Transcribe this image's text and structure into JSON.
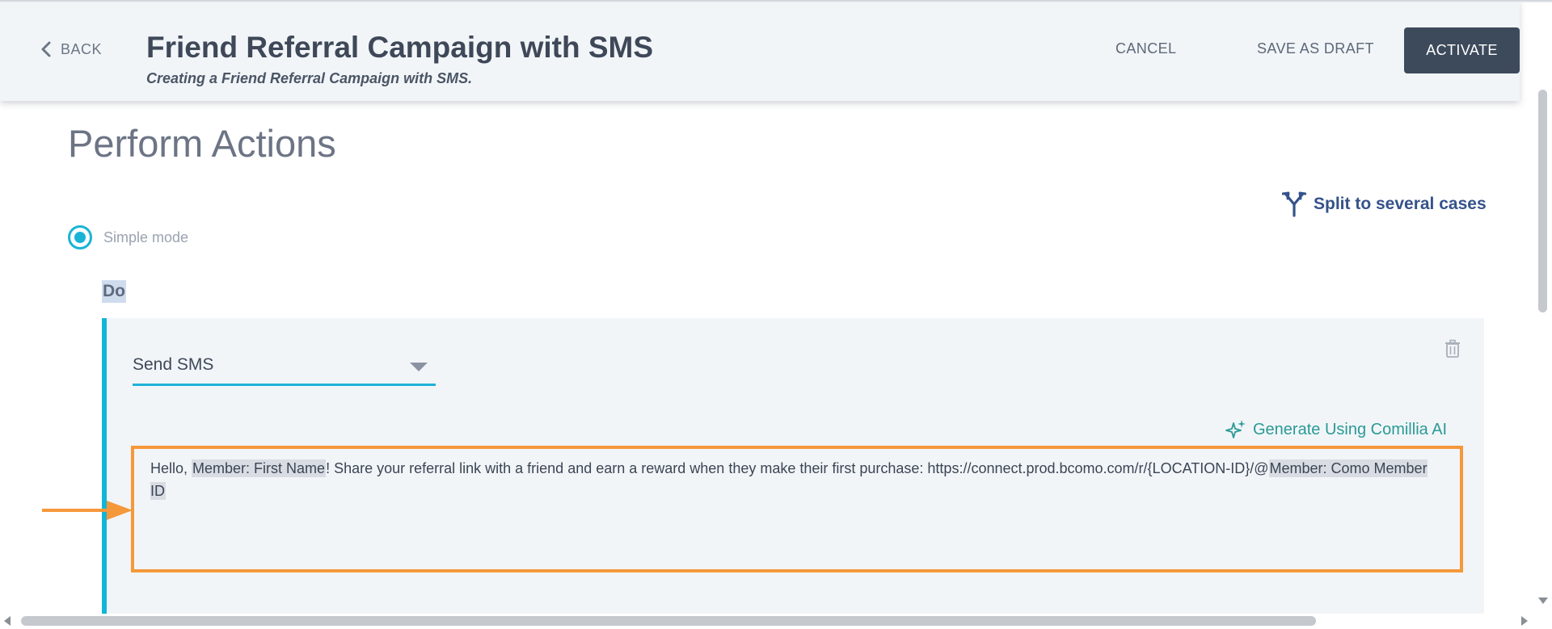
{
  "header": {
    "back_label": "BACK",
    "title": "Friend Referral Campaign with SMS",
    "subtitle": "Creating a Friend Referral Campaign with SMS.",
    "cancel_label": "CANCEL",
    "save_draft_label": "SAVE AS DRAFT",
    "activate_label": "ACTIVATE"
  },
  "section": {
    "title": "Perform Actions",
    "split_label": "Split to several cases",
    "mode_label": "Simple mode",
    "do_label": "Do"
  },
  "action": {
    "selected": "Send SMS",
    "ai_label": "Generate Using Comillia AI",
    "message": {
      "part1": "Hello, ",
      "chip_first_name": "Member: First Name",
      "part2": "! Share your referral link with a friend and earn a reward when they make their first purchase: https://connect.prod.bcomo.com/r/{LOCATION-ID}/@",
      "chip_member_id": "Member: Como Member ID"
    }
  },
  "icons": {
    "back": "chevron-left-icon",
    "split": "split-branch-icon",
    "trash": "trash-icon",
    "ai": "sparkle-icon",
    "caret": "caret-down-icon",
    "annotation": "arrow-right-icon"
  },
  "colors": {
    "accent": "#18b4d8",
    "activate_bg": "#3d4a5c",
    "highlight": "#f5983a",
    "ai": "#2a9a96",
    "link": "#35528a"
  }
}
